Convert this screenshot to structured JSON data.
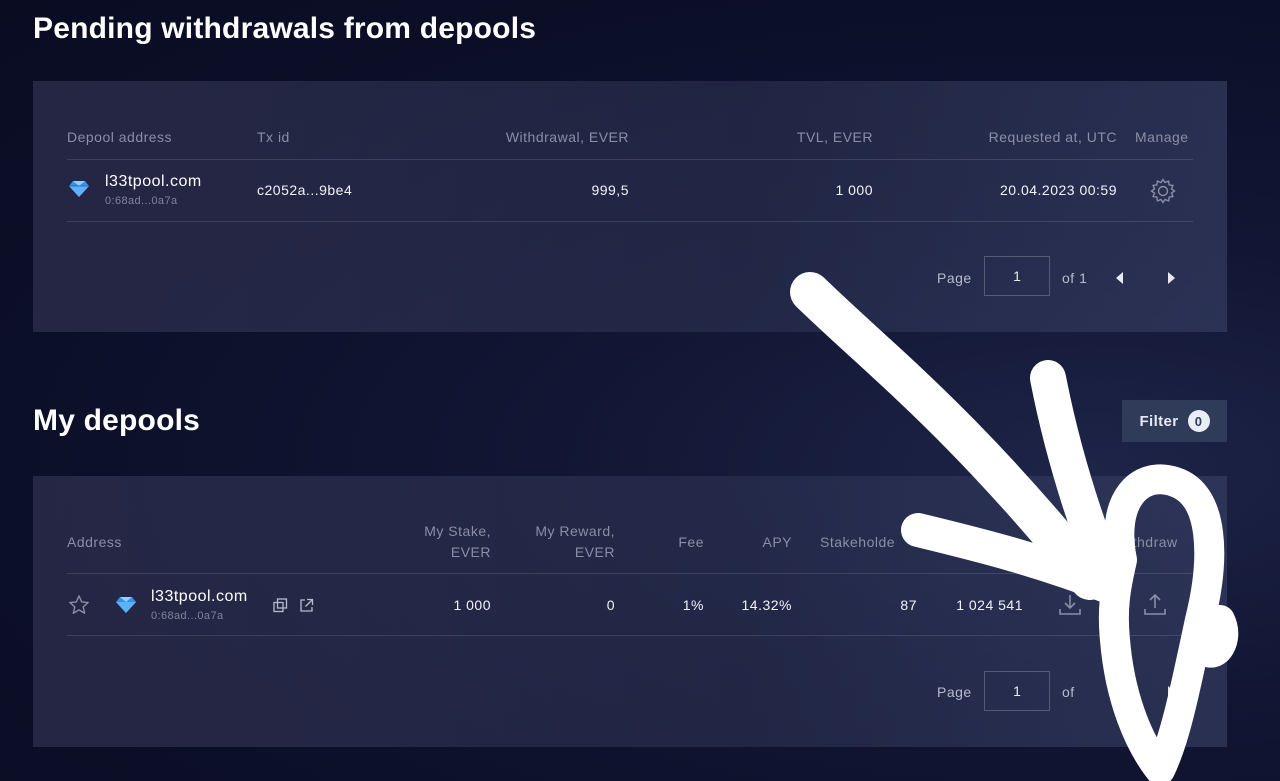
{
  "pending": {
    "title": "Pending withdrawals from depools",
    "headers": {
      "address": "Depool address",
      "tx": "Tx id",
      "withdrawal": "Withdrawal, EVER",
      "tvl": "TVL, EVER",
      "requested": "Requested at, UTC",
      "manage": "Manage"
    },
    "rows": [
      {
        "name": "l33tpool.com",
        "address": "0:68ad...0a7a",
        "tx": "c2052a...9be4",
        "withdrawal": "999,5",
        "tvl": "1 000",
        "requested": "20.04.2023 00:59"
      }
    ],
    "pager": {
      "label": "Page",
      "page": "1",
      "of": "of 1"
    }
  },
  "depools": {
    "title": "My depools",
    "filter": {
      "label": "Filter",
      "count": "0"
    },
    "headers": {
      "address": "Address",
      "stake_1": "My Stake,",
      "stake_2": "EVER",
      "reward_1": "My Reward,",
      "reward_2": "EVER",
      "fee": "Fee",
      "apy": "APY",
      "stakeholders": "Stakeholde",
      "withdraw": "ithdraw"
    },
    "rows": [
      {
        "name": "l33tpool.com",
        "address": "0:68ad...0a7a",
        "stake": "1 000",
        "reward": "0",
        "fee": "1%",
        "apy": "14.32%",
        "stakeholders": "87",
        "tvl": "1 024 541"
      }
    ],
    "pager": {
      "label": "Page",
      "page": "1",
      "of": "of"
    }
  },
  "colors": {
    "accent": "#4aa3ff",
    "filter_bg": "#2f3b58",
    "scribble": "#ffffff"
  },
  "icons": [
    "diamond-icon",
    "gear-icon",
    "star-icon",
    "copy-icon",
    "external-link-icon",
    "download-icon",
    "upload-icon",
    "arrow-left-icon",
    "arrow-right-icon"
  ]
}
